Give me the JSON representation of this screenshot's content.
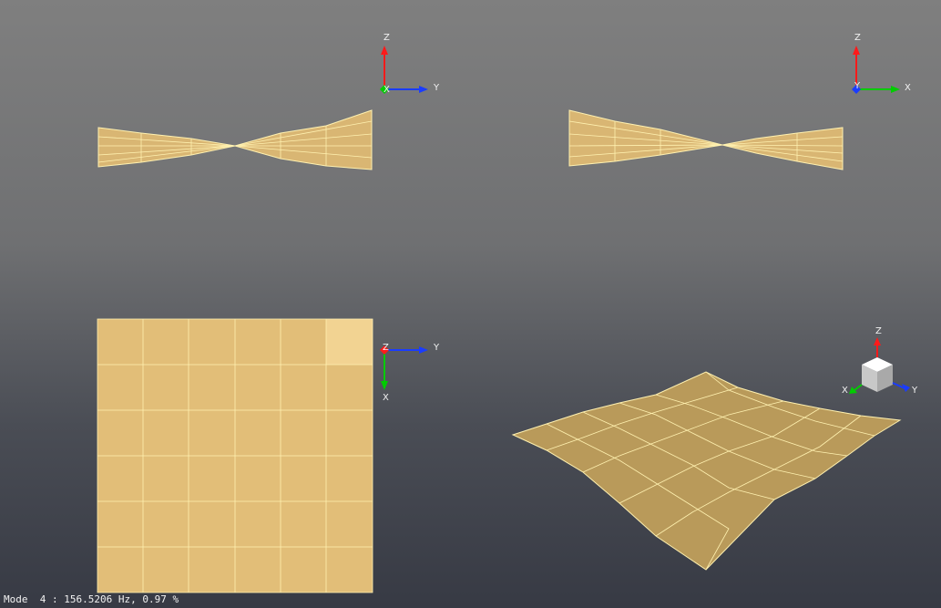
{
  "viewport": {
    "background_top": "#7f7f7f",
    "background_bottom": "#373a44",
    "mesh_fill": "#e9c57e",
    "mesh_line": "#fff1b0",
    "axis_colors": {
      "x": "#00cc00",
      "y": "#1a3cff",
      "z": "#ff1a1a"
    }
  },
  "views": [
    {
      "name": "side-view-yz-left",
      "axes": {
        "vertical": "Z",
        "horizontal": "Y",
        "out": "X"
      }
    },
    {
      "name": "side-view-xz-right",
      "axes": {
        "vertical": "Z",
        "horizontal": "X",
        "out": "Y"
      }
    },
    {
      "name": "top-view-xy",
      "axes": {
        "vertical": "X",
        "horizontal": "Y",
        "out": "Z"
      }
    },
    {
      "name": "iso-view",
      "axes": {
        "vertical": "Z",
        "horizontal": "Y",
        "out": "X"
      }
    }
  ],
  "status": {
    "mode_label": "Mode",
    "mode_number": "4",
    "separator": ":",
    "frequency": "156.5206 Hz,",
    "scale": "0.97 %"
  }
}
